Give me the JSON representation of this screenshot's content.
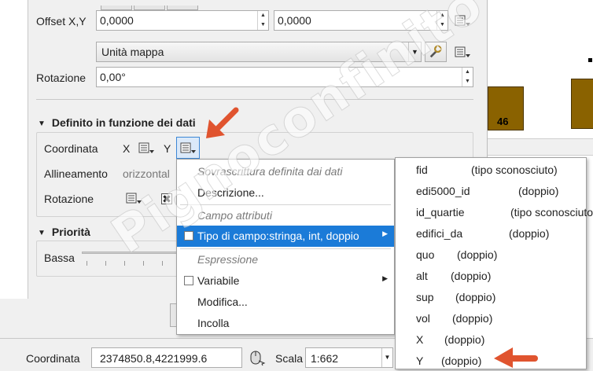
{
  "offset": {
    "label": "Offset X,Y",
    "x_value": "0,0000",
    "y_value": "0,0000"
  },
  "units": {
    "value": "Unità mappa"
  },
  "rotation_top": {
    "label": "Rotazione",
    "value": "0,00°"
  },
  "data_defined_group": {
    "title": "Definito in funzione dei dati",
    "coordinates_label": "Coordinata",
    "x_label": "X",
    "y_label": "Y",
    "alignment_label": "Allineamento",
    "alignment_value": "orizzontal",
    "rotation_label": "Rotazione",
    "rotation_checkbox": "✖"
  },
  "priority_group": {
    "title": "Priorità",
    "low_label": "Bassa"
  },
  "context_menu": {
    "header_override": "Sovrascrittura definita dai dati",
    "description": "Descrizione...",
    "header_field": "Campo attributi",
    "field_type": "Tipo di campo:stringa, int, doppio",
    "header_expression": "Espressione",
    "variable": "Variabile",
    "edit": "Modifica...",
    "paste": "Incolla"
  },
  "field_submenu": [
    {
      "name": "fid",
      "type": "(tipo sconosciuto)"
    },
    {
      "name": "edi5000_id",
      "type": "(doppio)"
    },
    {
      "name": "id_quartie",
      "type": "(tipo sconosciuto)"
    },
    {
      "name": "edifici_da",
      "type": "(doppio)"
    },
    {
      "name": "quo",
      "type": "(doppio)"
    },
    {
      "name": "alt",
      "type": "(doppio)"
    },
    {
      "name": "sup",
      "type": "(doppio)"
    },
    {
      "name": "vol",
      "type": "(doppio)"
    },
    {
      "name": "X",
      "type": "(doppio)"
    },
    {
      "name": "Y",
      "type": "(doppio)"
    }
  ],
  "statusbar": {
    "coordinate_label": "Coordinata",
    "coordinate_value": "2374850.8,4221999.6",
    "scale_label": "Scala",
    "scale_value": "1:662"
  },
  "map": {
    "feature_label": "46"
  },
  "watermark": "Pignoconfinito",
  "colors": {
    "accent": "#1b7bd8",
    "annotation_arrow": "#e0542f",
    "map_polygon": "#8a6200"
  },
  "icons": [
    "data-defined-icon",
    "wrench-icon",
    "mouse-pointer-icon",
    "submenu-arrow-icon",
    "annotation-arrow-icon"
  ]
}
